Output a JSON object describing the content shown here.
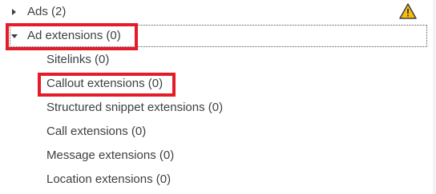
{
  "tree": {
    "ads_label": "Ads (2)",
    "ad_extensions_label": "Ad extensions (0)",
    "children": [
      {
        "label": "Sitelinks (0)"
      },
      {
        "label": "Callout extensions (0)"
      },
      {
        "label": "Structured snippet extensions (0)"
      },
      {
        "label": "Call extensions (0)"
      },
      {
        "label": "Message extensions (0)"
      },
      {
        "label": "Location extensions (0)"
      }
    ]
  },
  "icons": {
    "ads_expand": "chevron-right-icon",
    "ad_extensions_expand": "chevron-down-icon",
    "warning": "warning-icon"
  },
  "colors": {
    "highlight": "#e51b2a",
    "warning_fill": "#fbbc04",
    "text": "#3c4043"
  }
}
